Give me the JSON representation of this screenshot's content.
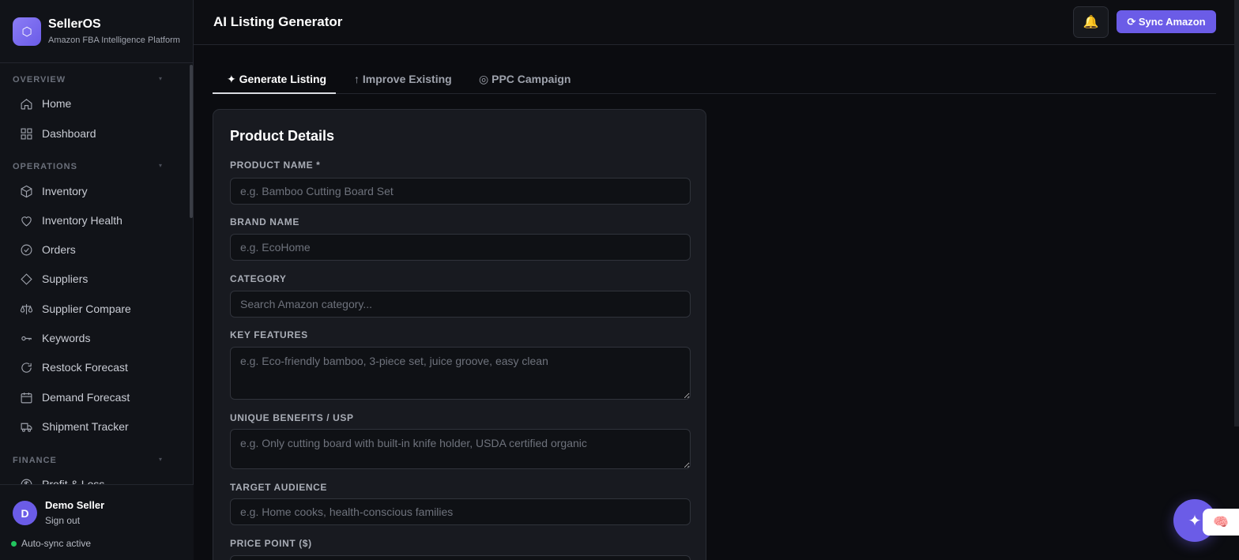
{
  "brand": {
    "name": "SellerOS",
    "subtitle": "Amazon FBA Intelligence Platform",
    "logo_icon": "hexagon-icon"
  },
  "sidebar": {
    "sections": [
      {
        "label": "OVERVIEW",
        "items": [
          {
            "label": "Home",
            "icon": "home-icon"
          },
          {
            "label": "Dashboard",
            "icon": "grid-icon"
          }
        ]
      },
      {
        "label": "OPERATIONS",
        "items": [
          {
            "label": "Inventory",
            "icon": "box-icon"
          },
          {
            "label": "Inventory Health",
            "icon": "heart-icon"
          },
          {
            "label": "Orders",
            "icon": "check-circle-icon"
          },
          {
            "label": "Suppliers",
            "icon": "diamond-icon"
          },
          {
            "label": "Supplier Compare",
            "icon": "scale-icon"
          },
          {
            "label": "Keywords",
            "icon": "key-icon"
          },
          {
            "label": "Restock Forecast",
            "icon": "refresh-icon"
          },
          {
            "label": "Demand Forecast",
            "icon": "calendar-icon"
          },
          {
            "label": "Shipment Tracker",
            "icon": "truck-icon"
          }
        ]
      },
      {
        "label": "FINANCE",
        "items": [
          {
            "label": "Profit & Loss",
            "icon": "dollar-circle-icon"
          }
        ]
      }
    ]
  },
  "user": {
    "initial": "D",
    "name": "Demo Seller",
    "signout": "Sign out",
    "sync_status": "Auto-sync active"
  },
  "header": {
    "title": "AI Listing Generator",
    "bell_icon": "bell-icon",
    "sync_label": "⟳ Sync Amazon"
  },
  "tabs": [
    {
      "label": "✦ Generate Listing",
      "active": true
    },
    {
      "label": "↑ Improve Existing",
      "active": false
    },
    {
      "label": "◎ PPC Campaign",
      "active": false
    }
  ],
  "form": {
    "title": "Product Details",
    "fields": [
      {
        "label": "PRODUCT NAME *",
        "placeholder": "e.g. Bamboo Cutting Board Set",
        "value": ""
      },
      {
        "label": "BRAND NAME",
        "placeholder": "e.g. EcoHome",
        "value": ""
      },
      {
        "label": "CATEGORY",
        "placeholder": "Search Amazon category...",
        "value": ""
      },
      {
        "label": "KEY FEATURES",
        "placeholder": "e.g. Eco-friendly bamboo, 3-piece set, juice groove, easy clean",
        "value": ""
      },
      {
        "label": "UNIQUE BENEFITS / USP",
        "placeholder": "e.g. Only cutting board with built-in knife holder, USDA certified organic",
        "value": ""
      },
      {
        "label": "TARGET AUDIENCE",
        "placeholder": "e.g. Home cooks, health-conscious families",
        "value": ""
      },
      {
        "label": "PRICE POINT ($)",
        "placeholder": "",
        "value": ""
      }
    ]
  },
  "floating": {
    "ai_button_icon": "sparkle-icon",
    "widget_icon": "brain-icon"
  },
  "colors": {
    "accent": "#6b5ce7",
    "background": "#0b0c10",
    "sync_dot": "#22c55e"
  }
}
